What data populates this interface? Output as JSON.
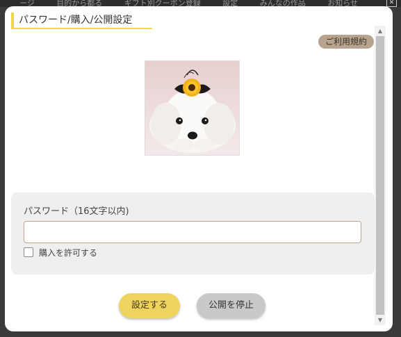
{
  "background": {
    "menu_items": [
      "ージ",
      "目的から都る",
      "ギフト別クーポン登録",
      "設定",
      "みんなの作品",
      "お知らせ"
    ]
  },
  "dialog": {
    "title": "パスワード/購入/公開設定",
    "terms_button": "ご利用規約",
    "photo_alt": "犬の写真",
    "form": {
      "password_label": "パスワード（16文字以内)",
      "password_value": "",
      "password_placeholder": "",
      "allow_purchase_label": "購入を許可する",
      "allow_purchase_checked": false
    },
    "buttons": {
      "set": "設定する",
      "stop": "公開を停止"
    }
  },
  "colors": {
    "accent_yellow": "#efd35f",
    "terms_bg": "#b7a48f",
    "stop_bg": "#c9c9c9"
  }
}
